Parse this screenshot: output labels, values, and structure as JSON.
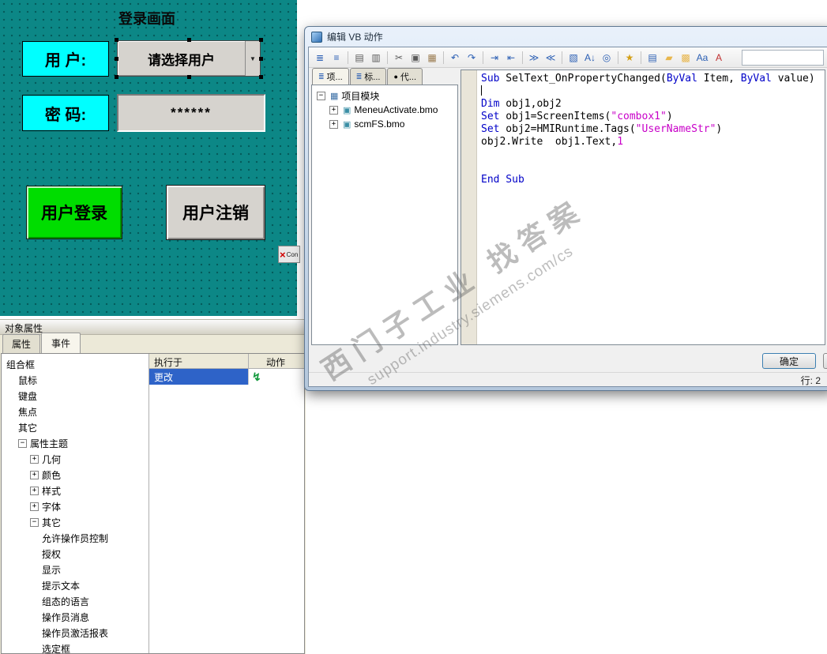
{
  "icons": {
    "chevron_down": "▼",
    "red_x": "×",
    "vb_lightning": "↯"
  },
  "hmi": {
    "screen_title": "登录画面",
    "user_label": "用 户:",
    "combo_text": "请选择用户",
    "password_label": "密 码:",
    "password_value": "******",
    "login_button": "用户登录",
    "logout_button": "用户注销",
    "control_placeholder": "Con"
  },
  "props": {
    "title": "对象属性",
    "tabs": [
      {
        "label": "属性",
        "active": false
      },
      {
        "label": "事件",
        "active": true
      }
    ],
    "tree_rows": [
      {
        "label": "组合框",
        "indent": 0,
        "box": null
      },
      {
        "label": "鼠标",
        "indent": 1,
        "box": null
      },
      {
        "label": "键盘",
        "indent": 1,
        "box": null
      },
      {
        "label": "焦点",
        "indent": 1,
        "box": null
      },
      {
        "label": "其它",
        "indent": 1,
        "box": null
      },
      {
        "label": "属性主题",
        "indent": 1,
        "box": "-"
      },
      {
        "label": "几何",
        "indent": 2,
        "box": "+"
      },
      {
        "label": "颜色",
        "indent": 2,
        "box": "+"
      },
      {
        "label": "样式",
        "indent": 2,
        "box": "+"
      },
      {
        "label": "字体",
        "indent": 2,
        "box": "+"
      },
      {
        "label": "其它",
        "indent": 2,
        "box": "-"
      },
      {
        "label": "允许操作员控制",
        "indent": 3,
        "box": null
      },
      {
        "label": "授权",
        "indent": 3,
        "box": null
      },
      {
        "label": "显示",
        "indent": 3,
        "box": null
      },
      {
        "label": "提示文本",
        "indent": 3,
        "box": null
      },
      {
        "label": "组态的语言",
        "indent": 3,
        "box": null
      },
      {
        "label": "操作员消息",
        "indent": 3,
        "box": null
      },
      {
        "label": "操作员激活报表",
        "indent": 3,
        "box": null
      },
      {
        "label": "选定框",
        "indent": 3,
        "box": null
      }
    ],
    "table": {
      "columns": [
        "执行于",
        "动作"
      ],
      "rows": [
        {
          "trigger": "更改"
        }
      ]
    }
  },
  "dialog": {
    "title": "编辑 VB 动作",
    "toolbar": [
      {
        "name": "properties-window-icon",
        "glyph": "≣",
        "color": "#2b5fb4"
      },
      {
        "name": "object-list-icon",
        "glyph": "≡",
        "color": "#2b5fb4"
      },
      {
        "sep": true
      },
      {
        "name": "print-icon",
        "glyph": "▤",
        "color": "#5a5a5a"
      },
      {
        "name": "print-preview-icon",
        "glyph": "▥",
        "color": "#5a5a5a"
      },
      {
        "sep": true
      },
      {
        "name": "cut-icon",
        "glyph": "✂",
        "color": "#5a5a5a"
      },
      {
        "name": "copy-icon",
        "glyph": "▣",
        "color": "#5a5a5a"
      },
      {
        "name": "paste-icon",
        "glyph": "▦",
        "color": "#9a7b4f"
      },
      {
        "sep": true
      },
      {
        "name": "undo-icon",
        "glyph": "↶",
        "color": "#2b5fb4"
      },
      {
        "name": "redo-icon",
        "glyph": "↷",
        "color": "#2b5fb4"
      },
      {
        "sep": true
      },
      {
        "name": "indent-increase-icon",
        "glyph": "⇥",
        "color": "#2b5fb4"
      },
      {
        "name": "indent-decrease-icon",
        "glyph": "⇤",
        "color": "#2b5fb4"
      },
      {
        "sep": true
      },
      {
        "name": "comment-lines-icon",
        "glyph": "≫",
        "color": "#2b5fb4"
      },
      {
        "name": "uncomment-lines-icon",
        "glyph": "≪",
        "color": "#2b5fb4"
      },
      {
        "sep": true
      },
      {
        "name": "bookmark-icon",
        "glyph": "▧",
        "color": "#2b5fb4"
      },
      {
        "name": "sort-az-icon",
        "glyph": "A↓",
        "color": "#2b5fb4"
      },
      {
        "name": "find-icon",
        "glyph": "◎",
        "color": "#2b5fb4"
      },
      {
        "sep": true
      },
      {
        "name": "key-icon",
        "glyph": "★",
        "color": "#d4a017"
      },
      {
        "sep": true
      },
      {
        "name": "module-book-icon",
        "glyph": "▤",
        "color": "#2b5fb4"
      },
      {
        "name": "folder-icon",
        "glyph": "▰",
        "color": "#e8b64c"
      },
      {
        "name": "package-icon",
        "glyph": "▩",
        "color": "#e8b64c"
      },
      {
        "name": "font-latin-icon",
        "glyph": "Aa",
        "color": "#2b5fb4"
      },
      {
        "name": "font-asian-icon",
        "glyph": "A",
        "color": "#c03030"
      }
    ],
    "tabs": [
      {
        "label": "项...",
        "icon_name": "project-tab-icon",
        "icon_glyph": "≣",
        "icon_color": "#2b5fb4",
        "active": true
      },
      {
        "label": "标...",
        "icon_name": "tags-tab-icon",
        "icon_glyph": "≣",
        "icon_color": "#2b5fb4",
        "active": false
      },
      {
        "label": "代...",
        "icon_name": "code-tab-icon",
        "icon_glyph": "●",
        "icon_color": "#000000",
        "active": false
      }
    ],
    "project_tree": [
      {
        "label": "项目模块",
        "indent": 0,
        "box": "-",
        "icon_name": "module-group-icon",
        "icon_glyph": "▦",
        "icon_color": "#3a6ea5"
      },
      {
        "label": "MeneuActivate.bmo",
        "indent": 1,
        "box": "+",
        "icon_name": "bmo-file-icon",
        "icon_glyph": "▣",
        "icon_color": "#3a8ea5"
      },
      {
        "label": "scmFS.bmo",
        "indent": 1,
        "box": "+",
        "icon_name": "bmo-file-icon",
        "icon_glyph": "▣",
        "icon_color": "#3a8ea5"
      }
    ],
    "code_lines": [
      [
        {
          "t": "Sub",
          "c": "kw"
        },
        {
          "t": " SelText_OnPropertyChanged(",
          "c": "tx"
        },
        {
          "t": "ByVal",
          "c": "kw"
        },
        {
          "t": " Item, ",
          "c": "tx"
        },
        {
          "t": "ByVal",
          "c": "kw"
        },
        {
          "t": " value)",
          "c": "tx"
        }
      ],
      [
        {
          "t": "",
          "c": "caret"
        }
      ],
      [
        {
          "t": "Dim",
          "c": "kw"
        },
        {
          "t": " obj1,obj2",
          "c": "tx"
        }
      ],
      [
        {
          "t": "Set",
          "c": "kw"
        },
        {
          "t": " obj1=ScreenItems(",
          "c": "tx"
        },
        {
          "t": "\"combox1\"",
          "c": "str"
        },
        {
          "t": ")",
          "c": "tx"
        }
      ],
      [
        {
          "t": "Set",
          "c": "kw"
        },
        {
          "t": " obj2=HMIRuntime.Tags(",
          "c": "tx"
        },
        {
          "t": "\"UserNameStr\"",
          "c": "str"
        },
        {
          "t": ")",
          "c": "tx"
        }
      ],
      [
        {
          "t": "obj2.Write  obj1.Text,",
          "c": "tx"
        },
        {
          "t": "1",
          "c": "str"
        }
      ],
      [],
      [],
      [
        {
          "t": "End Sub",
          "c": "kw"
        }
      ]
    ],
    "ok_button": "确定",
    "status_line": "行: 2"
  },
  "watermark": {
    "line1": "西门子工业    找答案",
    "line2": "support.industry.siemens.com/cs"
  }
}
